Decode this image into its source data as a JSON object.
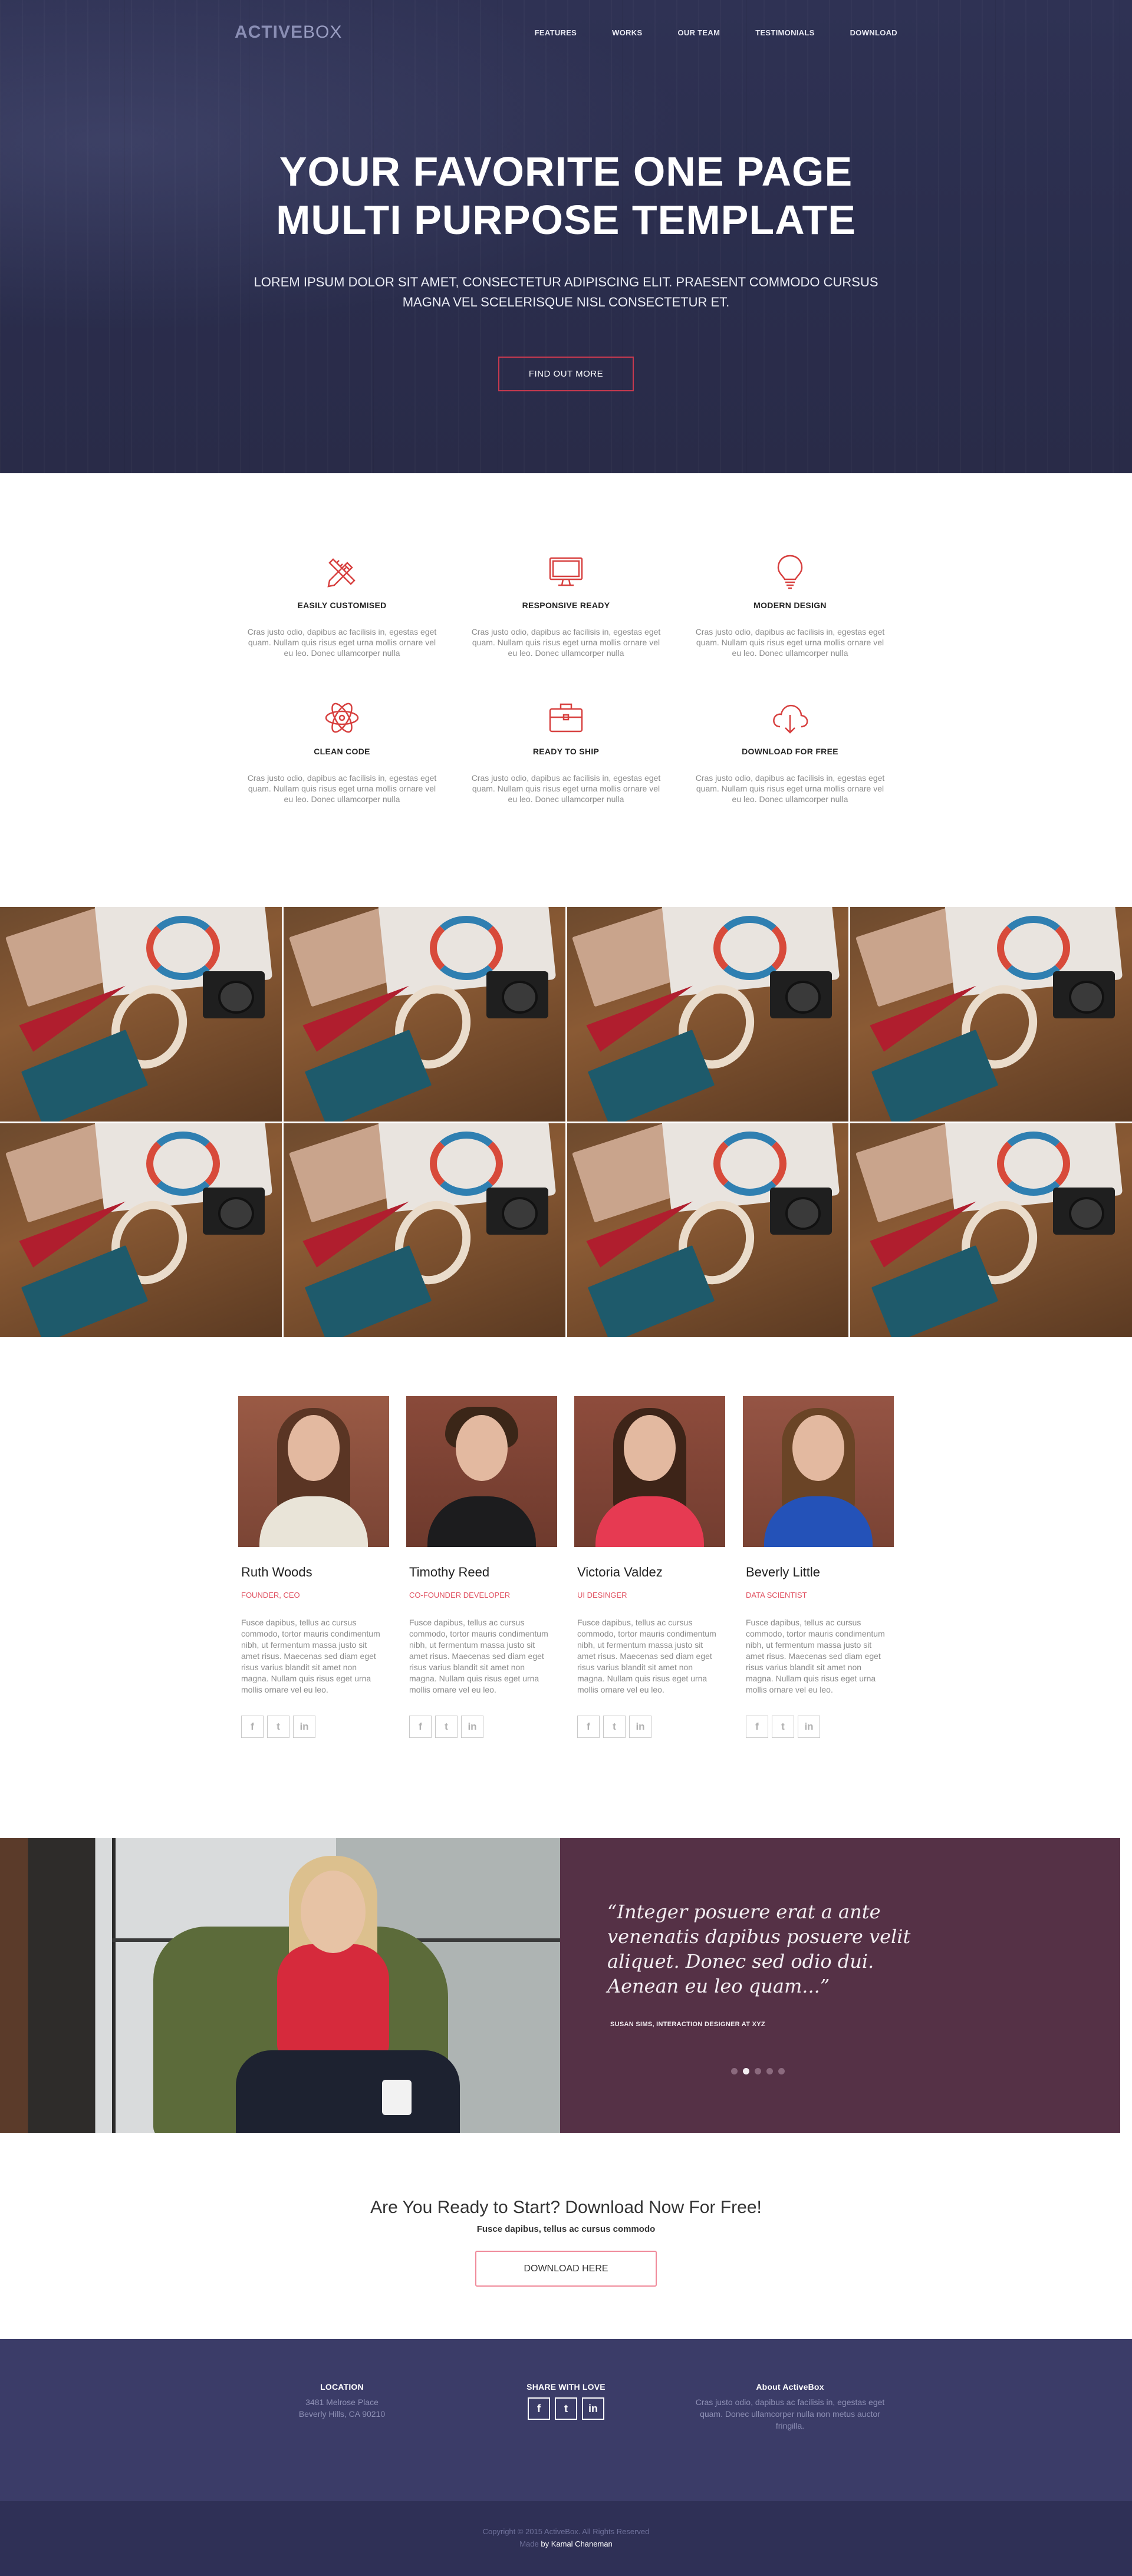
{
  "header": {
    "logo_part1": "ACTIVE",
    "logo_part2": "BOX",
    "nav": [
      "FEATURES",
      "WORKS",
      "OUR TEAM",
      "TESTIMONIALS",
      "DOWNLOAD"
    ]
  },
  "hero": {
    "title_line1": "YOUR FAVORITE ONE PAGE",
    "title_line2": "MULTI PURPOSE TEMPLATE",
    "subtitle": "LOREM IPSUM DOLOR SIT AMET, CONSECTETUR ADIPISCING ELIT. PRAESENT COMMODO CURSUS MAGNA VEL SCELERISQUE NISL CONSECTETUR ET.",
    "button": "FIND OUT MORE"
  },
  "features": [
    {
      "icon": "pencil-ruler-icon",
      "title": "EASILY CUSTOMISED",
      "text": "Cras justo odio, dapibus ac facilisis in, egestas eget quam. Nullam quis risus eget urna mollis ornare vel eu leo. Donec ullamcorper nulla"
    },
    {
      "icon": "monitor-icon",
      "title": "RESPONSIVE READY",
      "text": "Cras justo odio, dapibus ac facilisis in, egestas eget quam. Nullam quis risus eget urna mollis ornare vel eu leo. Donec ullamcorper nulla"
    },
    {
      "icon": "lightbulb-icon",
      "title": "MODERN DESIGN",
      "text": "Cras justo odio, dapibus ac facilisis in, egestas eget quam. Nullam quis risus eget urna mollis ornare vel eu leo. Donec ullamcorper nulla"
    },
    {
      "icon": "atom-icon",
      "title": "CLEAN CODE",
      "text": "Cras justo odio, dapibus ac facilisis in, egestas eget quam. Nullam quis risus eget urna mollis ornare vel eu leo. Donec ullamcorper nulla"
    },
    {
      "icon": "briefcase-icon",
      "title": "READY TO SHIP",
      "text": "Cras justo odio, dapibus ac facilisis in, egestas eget quam. Nullam quis risus eget urna mollis ornare vel eu leo. Donec ullamcorper nulla"
    },
    {
      "icon": "cloud-download-icon",
      "title": "DOWNLOAD FOR FREE",
      "text": "Cras justo odio, dapibus ac facilisis in, egestas eget quam. Nullam quis risus eget urna mollis ornare vel eu leo. Donec ullamcorper nulla"
    }
  ],
  "team": [
    {
      "name": "Ruth Woods",
      "role": "FOUNDER, CEO",
      "bio": "Fusce dapibus, tellus ac cursus commodo, tortor mauris condimentum nibh, ut fermentum massa justo sit amet risus. Maecenas sed diam eget risus varius blandit sit amet non magna. Nullam quis risus eget urna mollis ornare vel eu leo."
    },
    {
      "name": "Timothy Reed",
      "role": "CO-FOUNDER DEVELOPER",
      "bio": "Fusce dapibus, tellus ac cursus commodo, tortor mauris condimentum nibh, ut fermentum massa justo sit amet risus. Maecenas sed diam eget risus varius blandit sit amet non magna. Nullam quis risus eget urna mollis ornare vel eu leo."
    },
    {
      "name": "Victoria Valdez",
      "role": "UI DESINGER",
      "bio": "Fusce dapibus, tellus ac cursus commodo, tortor mauris condimentum nibh, ut fermentum massa justo sit amet risus. Maecenas sed diam eget risus varius blandit sit amet non magna. Nullam quis risus eget urna mollis ornare vel eu leo."
    },
    {
      "name": "Beverly Little",
      "role": "DATA SCIENTIST",
      "bio": "Fusce dapibus, tellus ac cursus commodo, tortor mauris condimentum nibh, ut fermentum massa justo sit amet risus. Maecenas sed diam eget risus varius blandit sit amet non magna. Nullam quis risus eget urna mollis ornare vel eu leo."
    }
  ],
  "social_glyphs": {
    "facebook": "f",
    "twitter": "t",
    "linkedin": "in"
  },
  "testimonial": {
    "quote": "“Integer posuere erat a ante venenatis dapibus posuere velit aliquet. Donec sed odio dui. Aenean eu leo quam...”",
    "author": "SUSAN SIMS, INTERACTION DESIGNER AT XYZ",
    "active_dot": 2,
    "dot_count": 5
  },
  "cta": {
    "title": "Are You Ready to Start? Download Now For Free!",
    "subtitle": "Fusce dapibus, tellus ac cursus commodo",
    "button": "DOWNLOAD HERE"
  },
  "footer": {
    "location_title": "LOCATION",
    "address_line1": "3481 Melrose Place",
    "address_line2": "Beverly Hills, CA 90210",
    "share_title": "SHARE WITH LOVE",
    "about_title": "About ActiveBox",
    "about_text": "Cras justo odio, dapibus ac facilisis in, egestas eget quam. Donec ullamcorper nulla non metus auctor fringilla.",
    "copyright": "Copyright © 2015 ActiveBox. All Rights Reserved",
    "made_by_prefix": "Made",
    "made_by_name": "by Kamal Chaneman"
  },
  "colors": {
    "hero_bg": "#2a2d4c",
    "accent_red": "#c7394f",
    "testimonial_bg": "#553146",
    "footer_bg": "#3b3c68",
    "footer_bottom_bg": "#2f3056"
  }
}
